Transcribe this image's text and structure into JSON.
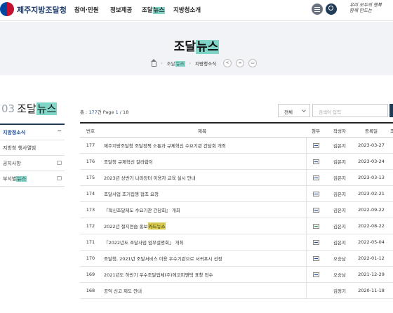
{
  "header": {
    "logo_text": "제주지방조달청",
    "nav": [
      {
        "label": "참여·민원"
      },
      {
        "label": "정보제공"
      },
      {
        "label_a": "조달",
        "label_b": "뉴스"
      },
      {
        "label": "지방청소개"
      }
    ],
    "slogan_line1": "우리 모두의 행복",
    "slogan_line2": "함께 만드는"
  },
  "banner": {
    "title_a": "조달",
    "title_b": "뉴스",
    "breadcrumb": {
      "level1_a": "조달",
      "level1_b": "뉴스",
      "level2": "지방청소식"
    }
  },
  "sidebar": {
    "num": "03",
    "title_a": "조달",
    "title_b": "뉴스",
    "items": [
      {
        "label": "지방청소식",
        "mark": "−"
      },
      {
        "label": "지방청 행사앨범"
      },
      {
        "label": "공지사항"
      },
      {
        "label_a": "부서별",
        "label_b": "뉴스"
      }
    ]
  },
  "toolbar": {
    "total_prefix": "총 : ",
    "total_count": "177",
    "total_mid": "건 Page ",
    "page_current": "1",
    "page_total": " / 18",
    "filter_value": "전체",
    "search_placeholder": "검색어 입력"
  },
  "table": {
    "headers": {
      "no": "번호",
      "title": "제목",
      "att": "첨부",
      "author": "작성자",
      "date": "등록일",
      "views": "조"
    },
    "rows": [
      {
        "no": "177",
        "title": "제주지방조달청 조달정책 소통과 규제혁신 수요기관 간담회 개최",
        "att": "file",
        "author": "김은지",
        "date": "2023-03-27"
      },
      {
        "no": "176",
        "title": "조달청 규제혁신 갈라합이",
        "att": "file",
        "author": "김은지",
        "date": "2023-03-24"
      },
      {
        "no": "175",
        "title": "2023년 상반기 나라장터 이용자 교육 실시 안내",
        "att": "file",
        "author": "김은지",
        "date": "2023-03-13"
      },
      {
        "no": "174",
        "title": "조달사업 조기집행 협조 요청",
        "att": "file",
        "author": "김은지",
        "date": "2023-02-21"
      },
      {
        "no": "173",
        "title": "『혁신조달제도 수요기관 간담회』 개최",
        "att": "file",
        "author": "김은지",
        "date": "2022-09-22"
      },
      {
        "no": "172",
        "title_a": "2022년 절지연습 홍보",
        "title_b": "카드뉴스",
        "att": "file-green",
        "author": "김은지",
        "date": "2022-08-22"
      },
      {
        "no": "171",
        "title": "『2022년도 조달사업 업무설명회』 개최",
        "att": "file",
        "author": "김은지",
        "date": "2022-05-04"
      },
      {
        "no": "170",
        "title": "조달청, 2021년 조달서비스 이용 우수기관으로 서귀포시 선정",
        "att": "file",
        "author": "오승남",
        "date": "2022-01-12"
      },
      {
        "no": "169",
        "title": "2021년도 하반기 우수조달업체(주)에코피앤텍 표창 전수",
        "att": "file",
        "author": "오승남",
        "date": "2021-12-29"
      },
      {
        "no": "168",
        "title": "공익 신고 제도 안내",
        "att": "",
        "author": "김정기",
        "date": "2020-11-18"
      }
    ]
  }
}
